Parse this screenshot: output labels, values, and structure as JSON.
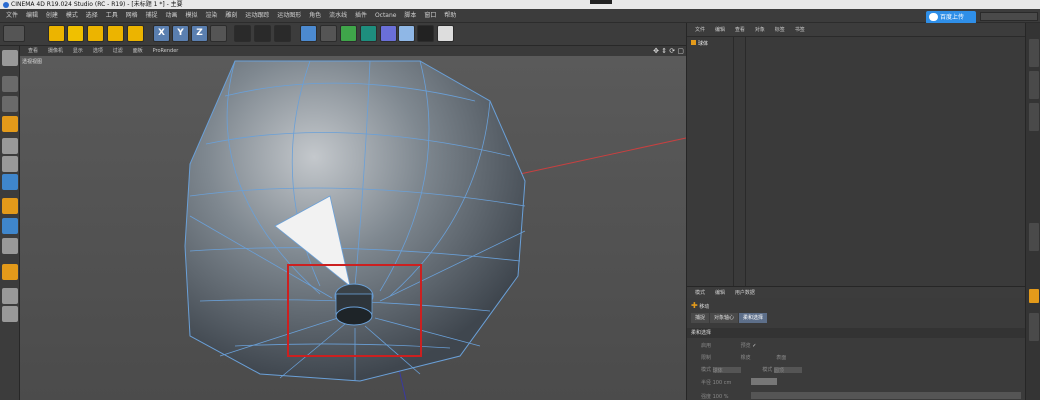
{
  "window": {
    "title": "CINEMA 4D R19.024 Studio (RC - R19) - [未标题 1 *] - 主要"
  },
  "menu": [
    "文件",
    "编辑",
    "创建",
    "模式",
    "选择",
    "工具",
    "网格",
    "捕捉",
    "动画",
    "模拟",
    "渲染",
    "雕刻",
    "运动跟踪",
    "运动图形",
    "角色",
    "流水线",
    "插件",
    "Octane",
    "脚本",
    "窗口",
    "帮助"
  ],
  "cloud_button": "百度上传",
  "toolbar": {
    "axis_x": "X",
    "axis_y": "Y",
    "axis_z": "Z"
  },
  "viewport": {
    "header_items": [
      "查看",
      "摄像机",
      "显示",
      "选项",
      "过滤",
      "面板",
      "ProRender"
    ],
    "label": "透视视图"
  },
  "object_manager": {
    "menu": [
      "文件",
      "编辑",
      "查看",
      "对象",
      "标签",
      "书签"
    ],
    "objects": [
      {
        "name": "球体"
      }
    ]
  },
  "attribute_manager": {
    "menu": [
      "模式",
      "编辑",
      "用户数据"
    ],
    "title": "移动",
    "tabs": [
      {
        "label": "捕捉"
      },
      {
        "label": "对象轴心"
      },
      {
        "label": "柔和选择",
        "active": true
      }
    ],
    "section": "柔和选择",
    "rows": [
      {
        "label": "启用",
        "value": "",
        "label2": "预览",
        "value2": "✓"
      },
      {
        "label": "限制",
        "value": "",
        "label2": "橡皮",
        "value2": "",
        "label3": "表面",
        "value3": ""
      },
      {
        "label": "模式",
        "value": "球体",
        "label2": "模式",
        "value2": "圆顶"
      },
      {
        "label": "半径",
        "value": "100 cm"
      },
      {
        "label": "强度",
        "value": "100 %"
      }
    ]
  },
  "colors": {
    "selection_rect": "#cc2020",
    "edge": "#6aa0d8",
    "accent": "#e39a1a"
  }
}
